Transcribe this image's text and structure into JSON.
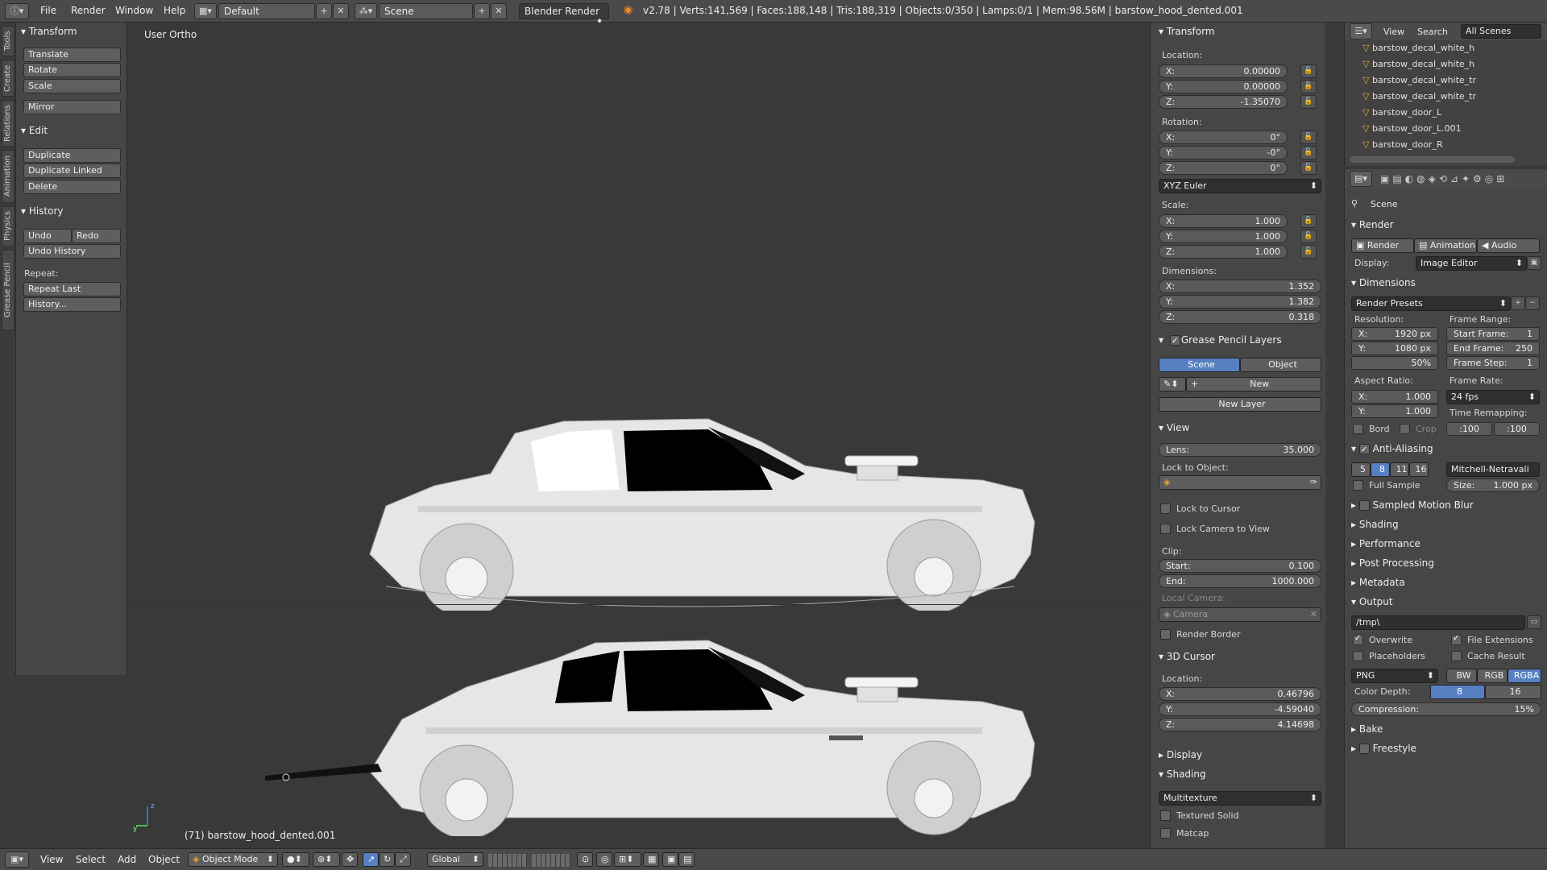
{
  "topbar": {
    "menus": [
      "File",
      "Render",
      "Window",
      "Help"
    ],
    "layout": "Default",
    "scene": "Scene",
    "engine": "Blender Render",
    "stats": "v2.78 | Verts:141,569 | Faces:188,148 | Tris:188,319 | Objects:0/350 | Lamps:0/1 | Mem:98.56M | barstow_hood_dented.001"
  },
  "left_tabs": [
    "Tools",
    "Create",
    "Relations",
    "Animation",
    "Physics",
    "Grease Pencil"
  ],
  "tools": {
    "transform_header": "Transform",
    "transform_buttons": [
      "Translate",
      "Rotate",
      "Scale",
      "Mirror"
    ],
    "edit_header": "Edit",
    "edit_buttons": [
      "Duplicate",
      "Duplicate Linked",
      "Delete"
    ],
    "history_header": "History",
    "undo": "Undo",
    "redo": "Redo",
    "undo_history": "Undo History",
    "repeat_label": "Repeat:",
    "repeat_last": "Repeat Last",
    "history_more": "History..."
  },
  "viewport": {
    "view_name": "User Ortho",
    "object_label": "(71) barstow_hood_dented.001"
  },
  "npanel": {
    "transform_header": "Transform",
    "location_label": "Location:",
    "location": [
      "0.00000",
      "0.00000",
      "-1.35070"
    ],
    "rotation_label": "Rotation:",
    "rotation": [
      "0°",
      "-0°",
      "0°"
    ],
    "rotation_mode": "XYZ Euler",
    "scale_label": "Scale:",
    "scale": [
      "1.000",
      "1.000",
      "1.000"
    ],
    "dimensions_label": "Dimensions:",
    "dimensions": [
      "1.352",
      "1.382",
      "0.318"
    ],
    "axis": [
      "X:",
      "Y:",
      "Z:"
    ],
    "gp_header": "Grease Pencil Layers",
    "gp_scene": "Scene",
    "gp_object": "Object",
    "gp_new": "New",
    "gp_new_layer": "New Layer",
    "view_header": "View",
    "lens_label": "Lens:",
    "lens_value": "35.000",
    "lock_to_object": "Lock to Object:",
    "lock_to_cursor": "Lock to Cursor",
    "lock_camera": "Lock Camera to View",
    "clip_label": "Clip:",
    "clip_start_label": "Start:",
    "clip_start": "0.100",
    "clip_end_label": "End:",
    "clip_end": "1000.000",
    "local_camera": "Local Camera:",
    "camera": "Camera",
    "render_border": "Render Border",
    "cursor_header": "3D Cursor",
    "cursor_location_label": "Location:",
    "cursor_location": [
      "0.46796",
      "-4.59040",
      "4.14698"
    ],
    "display_header": "Display",
    "shading_header": "Shading",
    "shading_mode": "Multitexture",
    "textured_solid": "Textured Solid",
    "matcap": "Matcap"
  },
  "outliner": {
    "menus": [
      "View",
      "Search"
    ],
    "scenes": "All Scenes",
    "items": [
      "barstow_decal_white_h",
      "barstow_decal_white_h",
      "barstow_decal_white_tr",
      "barstow_decal_white_tr",
      "barstow_door_L",
      "barstow_door_L.001",
      "barstow_door_R"
    ]
  },
  "props": {
    "scene_label": "Scene",
    "render_header": "Render",
    "render_btn": "Render",
    "animation_btn": "Animation",
    "audio_btn": "Audio",
    "display_label": "Display:",
    "display_value": "Image Editor",
    "dimensions_header": "Dimensions",
    "render_presets": "Render Presets",
    "resolution_label": "Resolution:",
    "res_x": "1920 px",
    "res_y": "1080 px",
    "res_pct": "50%",
    "frame_range_label": "Frame Range:",
    "start_frame_label": "Start Frame:",
    "start_frame": "1",
    "end_frame_label": "End Frame:",
    "end_frame": "250",
    "frame_step_label": "Frame Step:",
    "frame_step": "1",
    "aspect_label": "Aspect Ratio:",
    "aspect_x": "1.000",
    "aspect_y": "1.000",
    "frame_rate_label": "Frame Rate:",
    "frame_rate": "24 fps",
    "time_remap_label": "Time Remapping:",
    "remap_old": ":100",
    "remap_new": ":100",
    "bord": "Bord",
    "crop": "Crop",
    "aa_header": "Anti-Aliasing",
    "aa_samples": [
      "5",
      "8",
      "11",
      "16"
    ],
    "aa_filter": "Mitchell-Netravali",
    "full_sample": "Full Sample",
    "size_label": "Size:",
    "size_value": "1.000 px",
    "collapsed": [
      "Sampled Motion Blur",
      "Shading",
      "Performance",
      "Post Processing",
      "Metadata"
    ],
    "output_header": "Output",
    "output_path": "/tmp\\",
    "overwrite": "Overwrite",
    "file_ext": "File Extensions",
    "placeholders": "Placeholders",
    "cache_result": "Cache Result",
    "format": "PNG",
    "color_modes": [
      "BW",
      "RGB",
      "RGBA"
    ],
    "color_depth_label": "Color Depth:",
    "depth_8": "8",
    "depth_16": "16",
    "compression_label": "Compression:",
    "compression_value": "15%",
    "bake": "Bake",
    "freestyle": "Freestyle"
  },
  "bottombar": {
    "menus": [
      "View",
      "Select",
      "Add",
      "Object"
    ],
    "mode": "Object Mode",
    "orientation": "Global"
  }
}
